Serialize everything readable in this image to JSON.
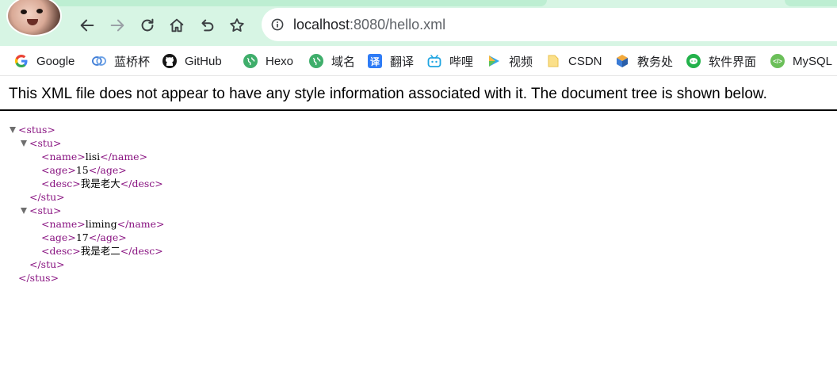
{
  "browser": {
    "url_host": "localhost",
    "url_rest": ":8080/hello.xml"
  },
  "bookmarks": [
    {
      "label": "Google",
      "icon": "google-icon",
      "color": "#4285f4"
    },
    {
      "label": "蓝桥杯",
      "icon": "lanqiao-icon",
      "color": "#3f7dd6"
    },
    {
      "label": "GitHub",
      "icon": "github-icon",
      "color": "#161616"
    },
    {
      "label": "Hexo",
      "icon": "globe-icon",
      "color": "#3fae6b"
    },
    {
      "label": "域名",
      "icon": "globe-icon",
      "color": "#3fae6b"
    },
    {
      "label": "翻译",
      "icon": "translate-icon",
      "color": "#2f7cf6"
    },
    {
      "label": "哔哩",
      "icon": "bilibili-icon",
      "color": "#20a5e1"
    },
    {
      "label": "视频",
      "icon": "video-play-icon",
      "color": "#2fa7ea"
    },
    {
      "label": "CSDN",
      "icon": "folder-icon",
      "color": "#f6d365"
    },
    {
      "label": "教务处",
      "icon": "cube-icon",
      "color": "#3a7bd5"
    },
    {
      "label": "软件界面",
      "icon": "wechat-icon",
      "color": "#23b24b"
    },
    {
      "label": "MySQL",
      "icon": "mysql-icon",
      "color": "#6bbf59"
    }
  ],
  "xml": {
    "header": "This XML file does not appear to have any style information associated with it. The document tree is shown below.",
    "tree": {
      "root_open": "<stus>",
      "root_close": "</stus>",
      "stu_open": "<stu>",
      "stu_close": "</stu>",
      "students": [
        {
          "name": "lisi",
          "age": "15",
          "desc": "我是老大"
        },
        {
          "name": "liming",
          "age": "17",
          "desc": "我是老二"
        }
      ],
      "name_open": "<name>",
      "name_close": "</name>",
      "age_open": "<age>",
      "age_close": "</age>",
      "desc_open": "<desc>",
      "desc_close": "</desc>"
    }
  }
}
